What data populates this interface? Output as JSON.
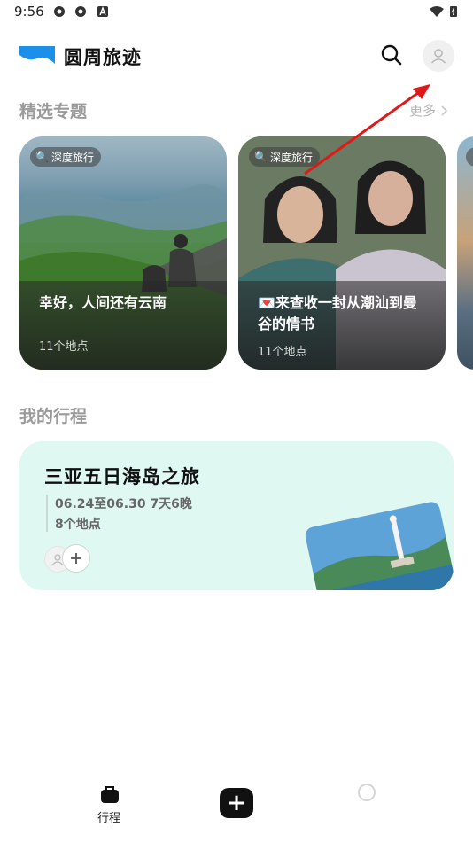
{
  "status_bar": {
    "time": "9:56"
  },
  "header": {
    "app_title": "圆周旅迹"
  },
  "featured": {
    "section_title": "精选专题",
    "more_label": "更多",
    "cards": [
      {
        "tag": "深度旅行",
        "title": "幸好，人间还有云南",
        "count": "11个地点"
      },
      {
        "tag": "深度旅行",
        "title_emoji": "💌",
        "title_line1": "来查收一封从潮汕到曼",
        "title_line2": "谷的情书",
        "count": "11个地点"
      }
    ]
  },
  "my_trips": {
    "section_title": "我的行程",
    "trip": {
      "title": "三亚五日海岛之旅",
      "dates": "06.24至06.30 7天6晚",
      "places": "8个地点"
    }
  },
  "tab_bar": {
    "trips_label": "行程",
    "add_label": "+"
  },
  "colors": {
    "brand_blue": "#1e8fe8",
    "trip_bg": "#dff8f2",
    "annotation_arrow": "#e01818"
  }
}
